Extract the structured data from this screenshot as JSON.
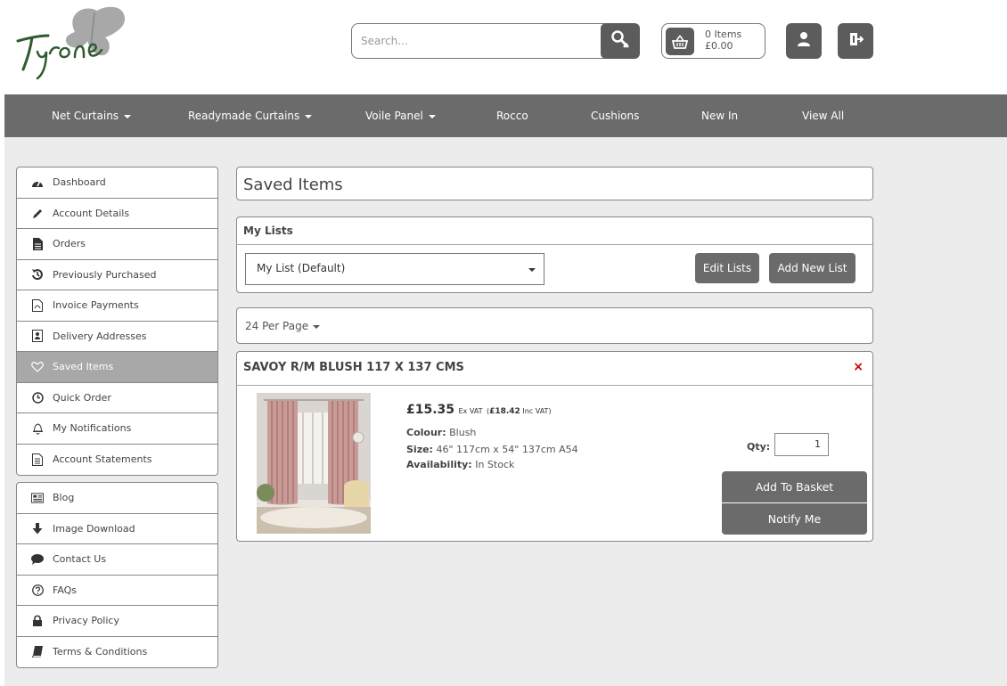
{
  "brand": {
    "logo_text": "Tyrone"
  },
  "search": {
    "placeholder": "Search..."
  },
  "basket": {
    "items": "0 Items",
    "total": "£0.00"
  },
  "nav": [
    {
      "label": "Net Curtains",
      "dropdown": true
    },
    {
      "label": "Readymade Curtains",
      "dropdown": true
    },
    {
      "label": "Voile Panel",
      "dropdown": true
    },
    {
      "label": "Rocco",
      "dropdown": false
    },
    {
      "label": "Cushions",
      "dropdown": false
    },
    {
      "label": "New In",
      "dropdown": false
    },
    {
      "label": "View All",
      "dropdown": false
    }
  ],
  "sidebar": {
    "account": [
      {
        "label": "Dashboard",
        "icon": "dashboard-icon"
      },
      {
        "label": "Account Details",
        "icon": "pencil-icon"
      },
      {
        "label": "Orders",
        "icon": "document-icon"
      },
      {
        "label": "Previously Purchased",
        "icon": "history-icon"
      },
      {
        "label": "Invoice Payments",
        "icon": "pdf-icon"
      },
      {
        "label": "Delivery Addresses",
        "icon": "address-book-icon"
      },
      {
        "label": "Saved Items",
        "icon": "heart-icon",
        "active": true
      },
      {
        "label": "Quick Order",
        "icon": "clock-icon"
      },
      {
        "label": "My Notifications",
        "icon": "bell-icon"
      },
      {
        "label": "Account Statements",
        "icon": "file-text-icon"
      }
    ],
    "info": [
      {
        "label": "Blog",
        "icon": "newspaper-icon"
      },
      {
        "label": "Image Download",
        "icon": "arrow-down-icon"
      },
      {
        "label": "Contact Us",
        "icon": "chat-icon"
      },
      {
        "label": "FAQs",
        "icon": "question-icon"
      },
      {
        "label": "Privacy Policy",
        "icon": "lock-icon"
      },
      {
        "label": "Terms & Conditions",
        "icon": "book-icon"
      }
    ]
  },
  "page": {
    "title": "Saved Items"
  },
  "lists": {
    "heading": "My Lists",
    "selected": "My List (Default)",
    "edit_label": "Edit Lists",
    "add_label": "Add New List"
  },
  "pagination": {
    "per_page": "24 Per Page"
  },
  "product": {
    "name": "SAVOY R/M BLUSH 117 X 137 CMS",
    "price_ex": "£15.35",
    "ex_vat_label": "Ex VAT",
    "price_inc": "£18.42",
    "inc_vat_label": "Inc VAT",
    "colour_label": "Colour:",
    "colour": "Blush",
    "size_label": "Size:",
    "size": "46\" 117cm x 54\" 137cm A54",
    "availability_label": "Availability:",
    "availability": "In Stock",
    "qty_label": "Qty:",
    "qty": "1",
    "add_label": "Add To Basket",
    "notify_label": "Notify Me",
    "remove_label": "×"
  },
  "colors": {
    "nav_bg": "#6b6b6b",
    "button_bg": "#6b6b6b",
    "page_bg": "#ececec",
    "remove": "#cc0000"
  }
}
